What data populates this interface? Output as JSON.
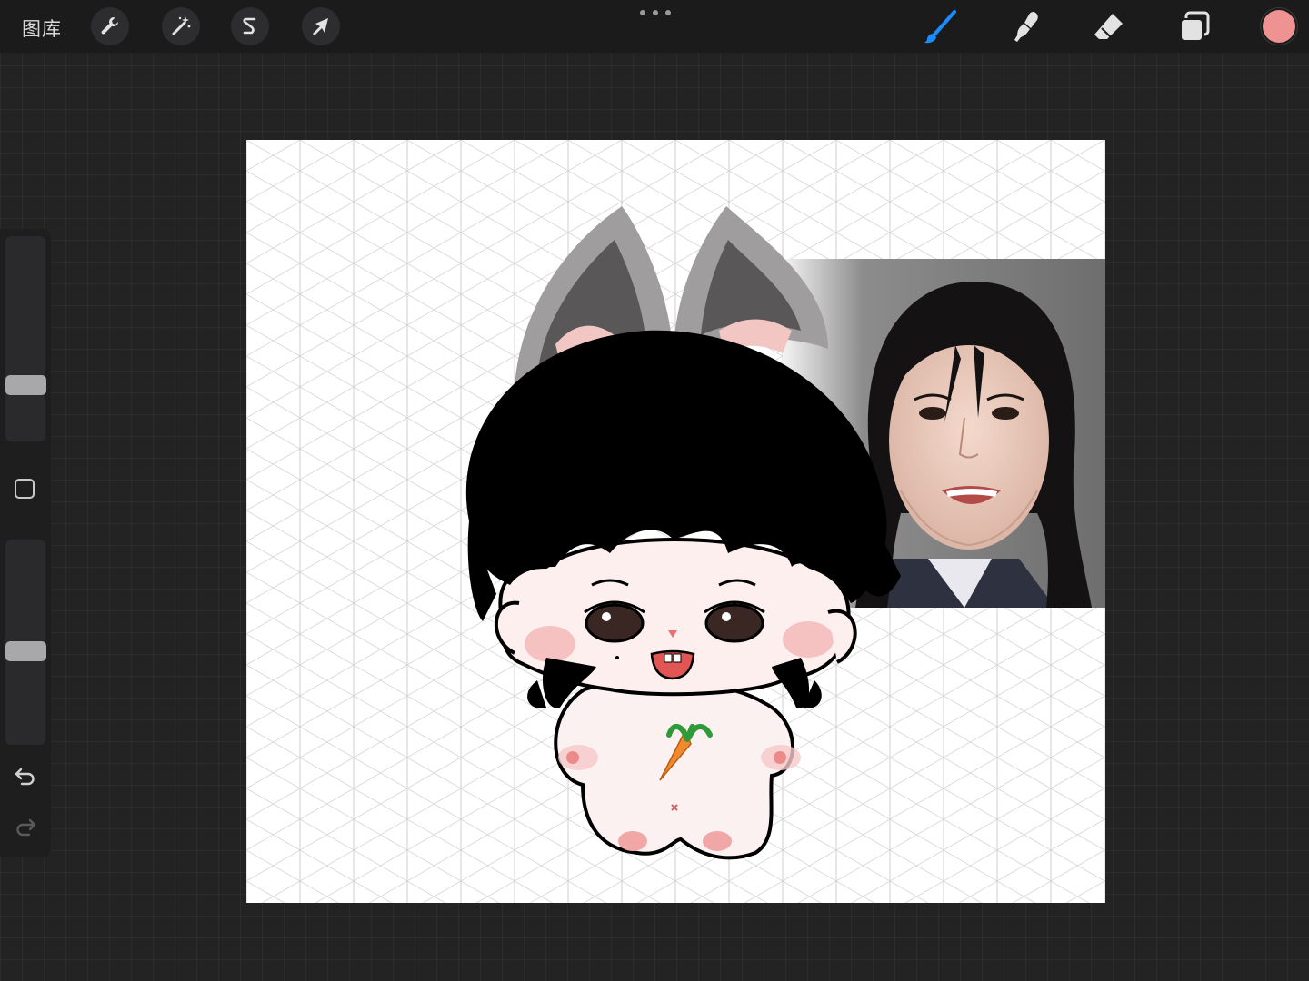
{
  "app": {
    "gallery_label": "图库"
  },
  "toolbar_left": {
    "actions": "wrench-icon",
    "adjustments": "magic-wand-icon",
    "selection": "selection-s-icon",
    "transform": "arrow-cursor-icon"
  },
  "toolbar_right": {
    "brush": "brush-icon",
    "smudge": "smudge-icon",
    "eraser": "eraser-icon",
    "layers": "layers-icon",
    "accent": "#1a8cff",
    "current_color": "#ee9391"
  },
  "sidebar": {
    "brush_size_level": 0.25,
    "opacity_level": 0.45
  }
}
